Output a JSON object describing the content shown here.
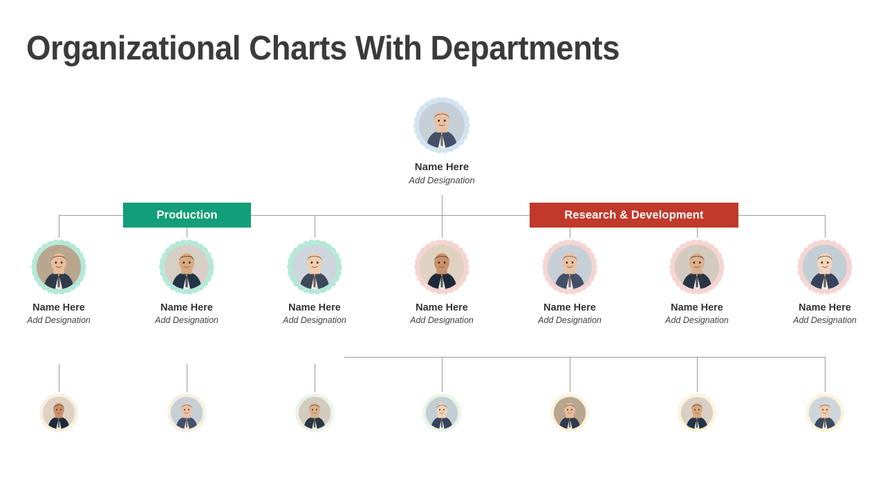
{
  "page": {
    "title": "Organizational Charts With Departments",
    "background_color": "#ffffff",
    "title_color": "#3b3b3b"
  },
  "colors": {
    "production_banner": "#129e78",
    "research_banner": "#c0392b",
    "connector_line": "#9a9a9a",
    "root_ring": "#d3e4f1",
    "production_ring": "#b6e8d8",
    "research_ring": "#f5d5d2",
    "row3_cream_ring": "#f7efe0",
    "row3_green_ring": "#eaf4e4",
    "row3_yellow_ring": "#fdf3dc"
  },
  "root": {
    "name": "Name Here",
    "designation": "Add Designation",
    "ring_color": "#d3e4f1",
    "avatar": "avatar-male-suit-wood-background"
  },
  "departments": [
    {
      "id": "production",
      "label": "Production",
      "color": "#129e78"
    },
    {
      "id": "research",
      "label": "Research & Development",
      "color": "#c0392b"
    }
  ],
  "level2": [
    {
      "name": "Name Here",
      "designation": "Add Designation",
      "ring_color": "#b6e8d8",
      "department": "Production",
      "avatar": "avatar-man-glasses-striped-shirt"
    },
    {
      "name": "Name Here",
      "designation": "Add Designation",
      "ring_color": "#b6e8d8",
      "department": "Production",
      "avatar": "avatar-man-beard-dark-suit"
    },
    {
      "name": "Name Here",
      "designation": "Add Designation",
      "ring_color": "#b6e8d8",
      "department": "Production",
      "avatar": "avatar-man-white-shirt-tie"
    },
    {
      "name": "Name Here",
      "designation": "Add Designation",
      "ring_color": "#f5d5d2",
      "department": "Research & Development",
      "avatar": "avatar-woman-smiling-long-hair"
    },
    {
      "name": "Name Here",
      "designation": "Add Designation",
      "ring_color": "#f5d5d2",
      "department": "Research & Development",
      "avatar": "avatar-man-blue-suit"
    },
    {
      "name": "Name Here",
      "designation": "Add Designation",
      "ring_color": "#f5d5d2",
      "department": "Research & Development",
      "avatar": "avatar-woman-curly-hair-blazer"
    },
    {
      "name": "Name Here",
      "designation": "Add Designation",
      "ring_color": "#f5d5d2",
      "department": "Research & Development",
      "avatar": "avatar-man-light-shirt"
    }
  ],
  "level3": [
    {
      "ring_color": "#f7efe0",
      "avatar": "avatar-man-beard-outdoor"
    },
    {
      "ring_color": "#f7efe0",
      "avatar": "avatar-man-dark-suit-older"
    },
    {
      "ring_color": "#eaf4e4",
      "avatar": "avatar-woman-dark-hair-blazer"
    },
    {
      "ring_color": "#eaf4e4",
      "avatar": "avatar-woman-smiling-office"
    },
    {
      "ring_color": "#fdf3dc",
      "avatar": "avatar-man-glasses-cap"
    },
    {
      "ring_color": "#fdf3dc",
      "avatar": "avatar-man-glasses-suit"
    },
    {
      "ring_color": "#fdf3dc",
      "avatar": "avatar-man-open-collar"
    }
  ]
}
